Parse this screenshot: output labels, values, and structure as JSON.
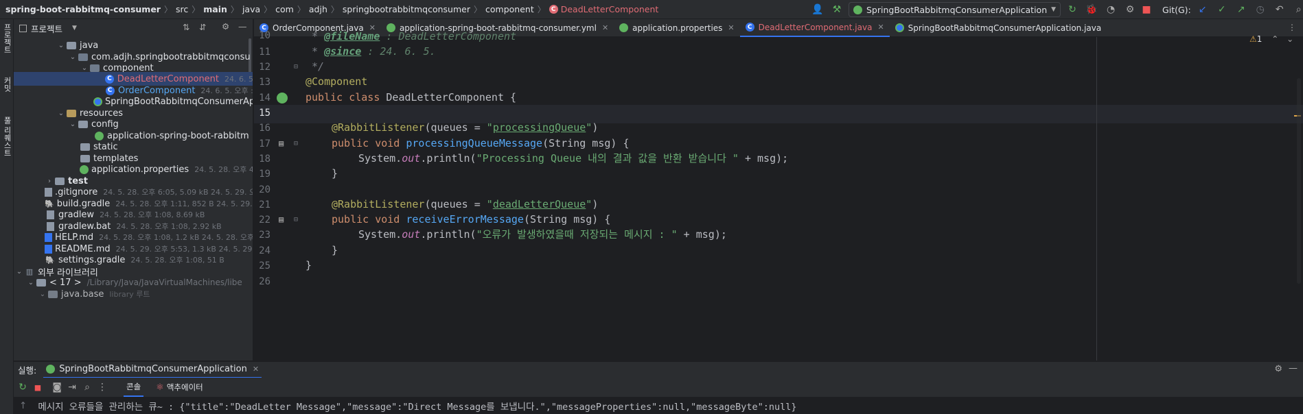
{
  "navbar": {
    "breadcrumbs": [
      "spring-boot-rabbitmq-consumer",
      "src",
      "main",
      "java",
      "com",
      "adjh",
      "springbootrabbitmqconsumer",
      "component",
      "DeadLetterComponent"
    ],
    "run_config": "SpringBootRabbitmqConsumerApplication",
    "git_label": "Git(G):"
  },
  "sidebar_tabs": [
    "프로젝트",
    "커밋",
    "풀 리퀘스트"
  ],
  "project": {
    "title": "프로젝트",
    "tree": [
      {
        "label": "java",
        "meta": ""
      },
      {
        "label": "com.adjh.springbootrabbitmqconsu",
        "meta": ""
      },
      {
        "label": "component",
        "meta": ""
      },
      {
        "label": "DeadLetterComponent",
        "meta": "24. 6. 5"
      },
      {
        "label": "OrderComponent",
        "meta": "24. 6. 5. 오후 :"
      },
      {
        "label": "SpringBootRabbitmqConsumerAp",
        "meta": ""
      },
      {
        "label": "resources",
        "meta": ""
      },
      {
        "label": "config",
        "meta": ""
      },
      {
        "label": "application-spring-boot-rabbitm",
        "meta": ""
      },
      {
        "label": "static",
        "meta": ""
      },
      {
        "label": "templates",
        "meta": ""
      },
      {
        "label": "application.properties",
        "meta": "24. 5. 28. 오후 4"
      },
      {
        "label": "test",
        "meta": ""
      },
      {
        "label": ".gitignore",
        "meta": "24. 5. 28. 오후 6:05, 5.09 kB 24. 5. 29. 오"
      },
      {
        "label": "build.gradle",
        "meta": "24. 5. 28. 오후 1:11, 852 B 24. 5. 29. 오"
      },
      {
        "label": "gradlew",
        "meta": "24. 5. 28. 오후 1:08, 8.69 kB"
      },
      {
        "label": "gradlew.bat",
        "meta": "24. 5. 28. 오후 1:08, 2.92 kB"
      },
      {
        "label": "HELP.md",
        "meta": "24. 5. 28. 오후 1:08, 1.2 kB 24. 5. 28. 오후"
      },
      {
        "label": "README.md",
        "meta": "24. 5. 29. 오후 5:53, 1.3 kB 24. 5. 29."
      },
      {
        "label": "settings.gradle",
        "meta": "24. 5. 28. 오후 1:08, 51 B"
      },
      {
        "label": "외부 라이브러리",
        "meta": ""
      },
      {
        "label": "< 17 >",
        "meta": "/Library/Java/JavaVirtualMachines/libe"
      },
      {
        "label": "java.base",
        "meta": "library 루트"
      }
    ]
  },
  "tabs": [
    {
      "label": "OrderComponent.java"
    },
    {
      "label": "application-spring-boot-rabbitmq-consumer.yml"
    },
    {
      "label": "application.properties"
    },
    {
      "label": "DeadLetterComponent.java"
    },
    {
      "label": "SpringBootRabbitmqConsumerApplication.java"
    }
  ],
  "editor": {
    "line_numbers": [
      "10",
      "11",
      "12",
      "13",
      "14",
      "15",
      "16",
      "17",
      "18",
      "19",
      "20",
      "21",
      "22",
      "23",
      "24",
      "25",
      "26"
    ],
    "warning_count": "1",
    "doc_tag_1": "@fileName",
    "doc_val_1": " : DeadLetterComponent",
    "doc_tag_2": "@since",
    "doc_val_2": " : 24. 6. 5.",
    "doc_close": " */",
    "annotation_component": "@Component",
    "kw_public": "public",
    "kw_class": "class",
    "class_name": " DeadLetterComponent {",
    "rabbit_annotation": "@RabbitListener",
    "queues_prefix": "(queues = ",
    "queue1": "processingQueue",
    "queue2": "deadLetterQueue",
    "kw_void": "void",
    "method1": "processingQueueMessage",
    "method2": "receiveErrorMessage",
    "params": "(String msg) {",
    "system": "System.",
    "out": "out",
    "println": ".println(",
    "msg1": "\"Processing Queue 내의 결과 값을 반환 받습니다 \"",
    "msg2": "\"오류가 발생하였을때 저장되는 메시지 : \"",
    "concat": " + msg);",
    "close_brace": "}"
  },
  "run": {
    "label": "실행:",
    "config": "SpringBootRabbitmqConsumerApplication",
    "console_tab": "콘솔",
    "actuator_tab": "액추에이터",
    "console_output": "메시지 오류들을 관리하는 큐~ : {\"title\":\"DeadLetter Message\",\"message\":\"Direct Message를 보냅니다.\",\"messageProperties\":null,\"messageByte\":null}"
  }
}
